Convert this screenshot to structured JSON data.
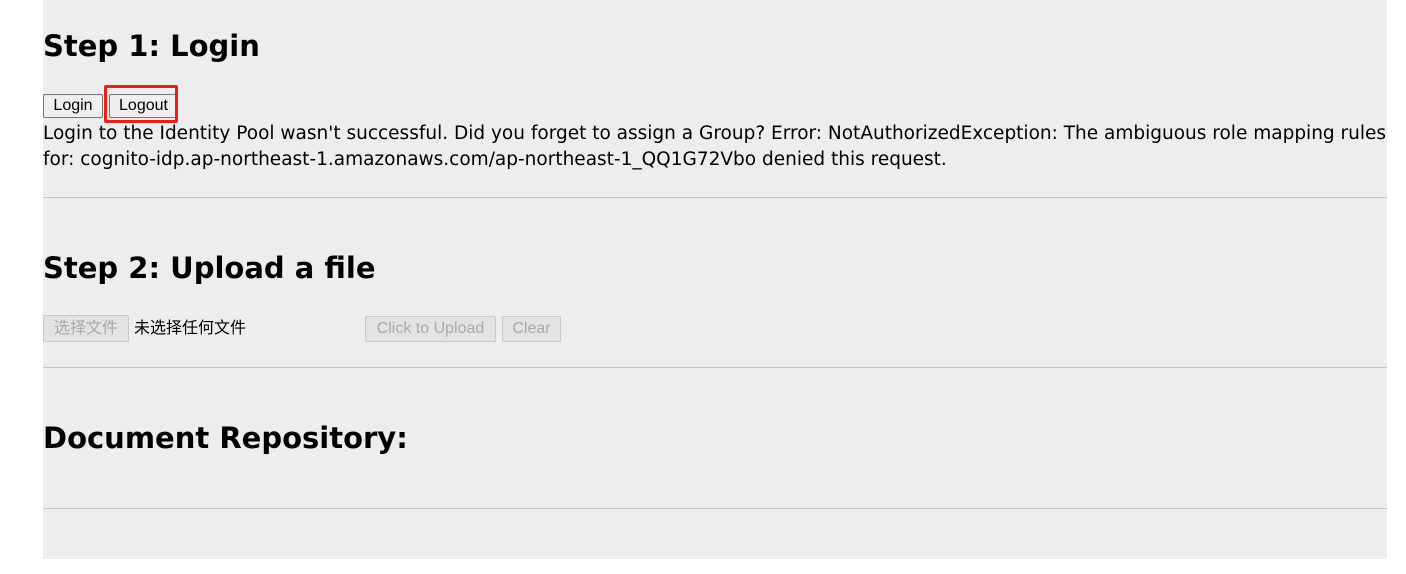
{
  "step1": {
    "heading": "Step 1: Login",
    "login_label": "Login",
    "logout_label": "Logout",
    "error_message": "Login to the Identity Pool wasn't successful. Did you forget to assign a Group? Error: NotAuthorizedException: The ambiguous role mapping rules for: cognito-idp.ap-northeast-1.amazonaws.com/ap-northeast-1_QQ1G72Vbo denied this request."
  },
  "step2": {
    "heading": "Step 2: Upload a file",
    "choose_file_label": "选择文件",
    "file_status": "未选择任何文件",
    "upload_label": "Click to Upload",
    "clear_label": "Clear"
  },
  "repository": {
    "heading": "Document Repository:"
  },
  "colors": {
    "panel_background": "#ededed",
    "highlight_border": "#e8201a"
  }
}
